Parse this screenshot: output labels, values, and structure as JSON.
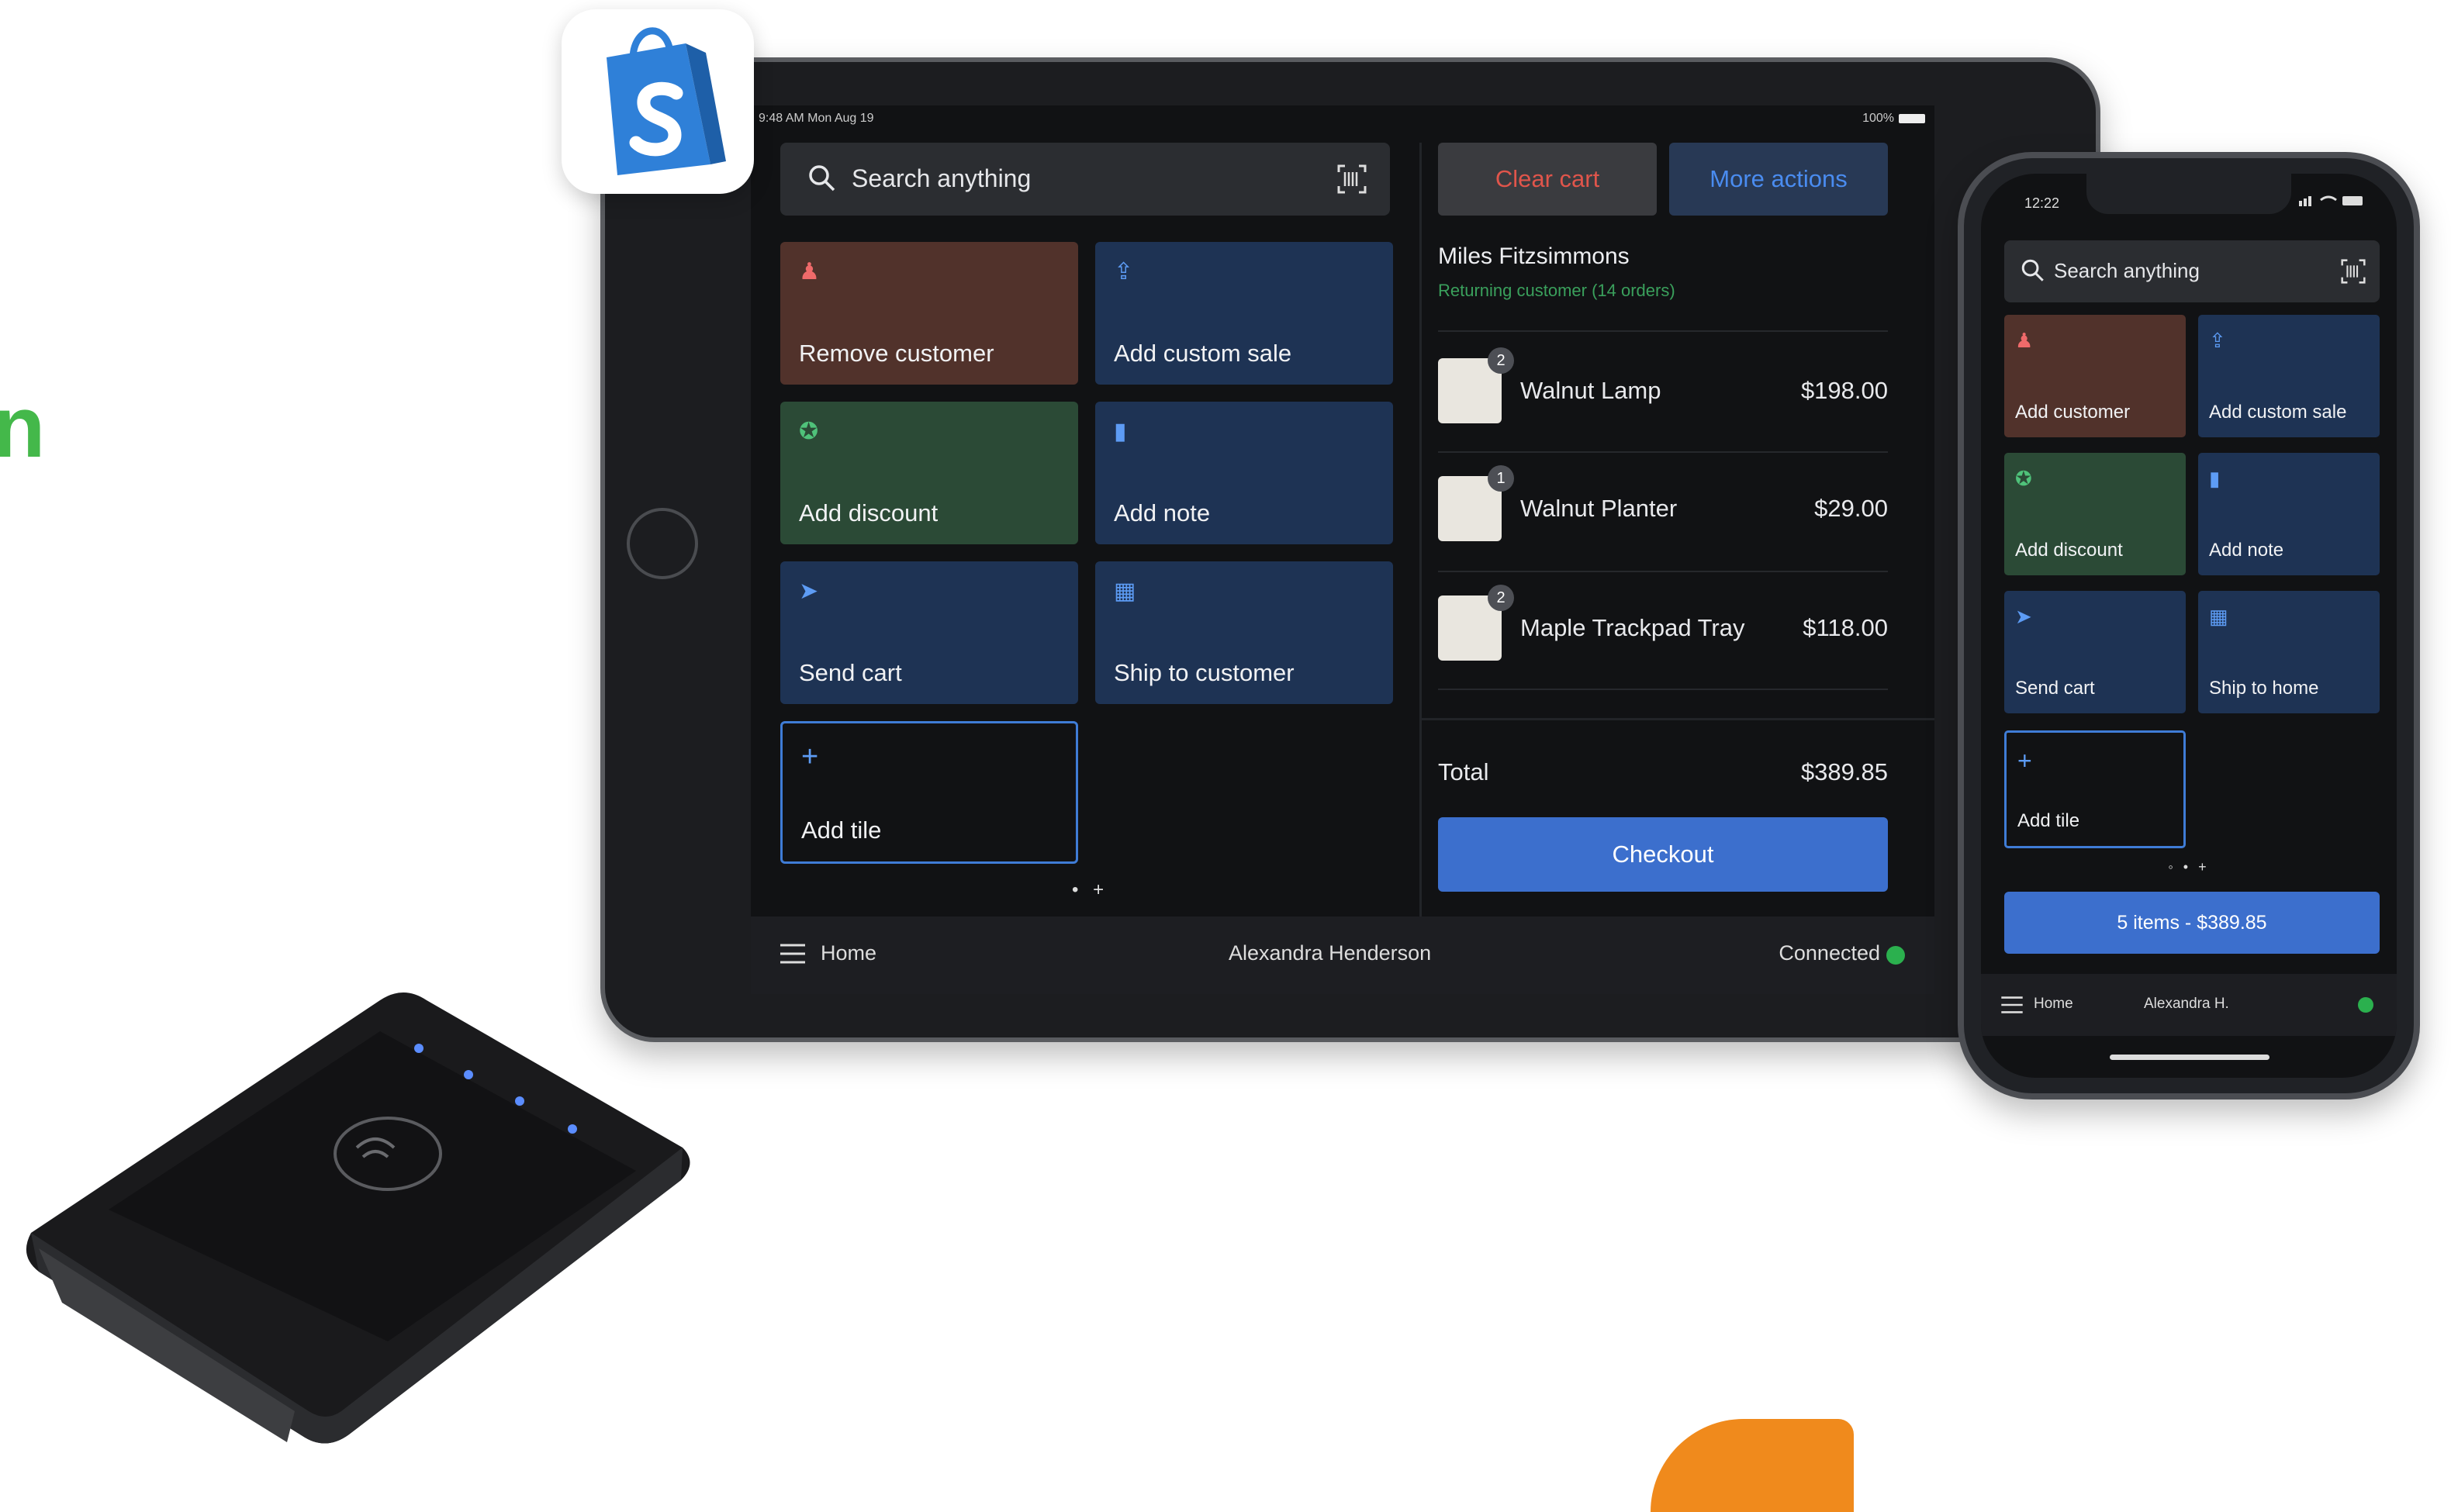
{
  "side_text": {
    "partial_letter": "n"
  },
  "tablet": {
    "status_time": "9:48 AM  Mon Aug 19",
    "status_battery": "100%",
    "search_placeholder": "Search anything",
    "tiles": [
      {
        "label": "Remove customer",
        "icon": "person-icon",
        "color": "#51322b"
      },
      {
        "label": "Add custom sale",
        "icon": "upload-icon",
        "color": "#1e3354"
      },
      {
        "label": "Add discount",
        "icon": "discount-icon",
        "color": "#2b4a36"
      },
      {
        "label": "Add note",
        "icon": "note-icon",
        "color": "#1e3354"
      },
      {
        "label": "Send cart",
        "icon": "send-icon",
        "color": "#1e3354"
      },
      {
        "label": "Ship to customer",
        "icon": "ship-icon",
        "color": "#1e3354"
      },
      {
        "label": "Add tile",
        "icon": "plus-icon",
        "color": "#111214"
      }
    ],
    "page_dots": "• +",
    "cart": {
      "clear_label": "Clear cart",
      "more_label": "More actions",
      "customer_name": "Miles Fitzsimmons",
      "customer_sub": "Returning customer (14 orders)",
      "items": [
        {
          "qty": "2",
          "name": "Walnut Lamp",
          "price": "$198.00"
        },
        {
          "qty": "1",
          "name": "Walnut Planter",
          "price": "$29.00"
        },
        {
          "qty": "2",
          "name": "Maple Trackpad Tray",
          "price": "$118.00"
        }
      ],
      "total_label": "Total",
      "total_value": "$389.85",
      "checkout_label": "Checkout"
    },
    "bottom": {
      "home": "Home",
      "user": "Alexandra Henderson",
      "status": "Connected"
    }
  },
  "phone": {
    "time": "12:22",
    "search_placeholder": "Search anything",
    "tiles": [
      {
        "label": "Add customer",
        "icon": "person-icon"
      },
      {
        "label": "Add custom sale",
        "icon": "upload-icon"
      },
      {
        "label": "Add discount",
        "icon": "discount-icon"
      },
      {
        "label": "Add note",
        "icon": "note-icon"
      },
      {
        "label": "Send cart",
        "icon": "send-icon"
      },
      {
        "label": "Ship to home",
        "icon": "ship-icon"
      },
      {
        "label": "Add tile",
        "icon": "plus-icon"
      }
    ],
    "page_dots": "◦ • +",
    "cart_button": "5 items - $389.85",
    "bottom": {
      "home": "Home",
      "user": "Alexandra H."
    }
  },
  "colors": {
    "accent": "#3c6fcd",
    "connected": "#2bb04e",
    "danger": "#e0554b",
    "brand": "#44b84a"
  }
}
